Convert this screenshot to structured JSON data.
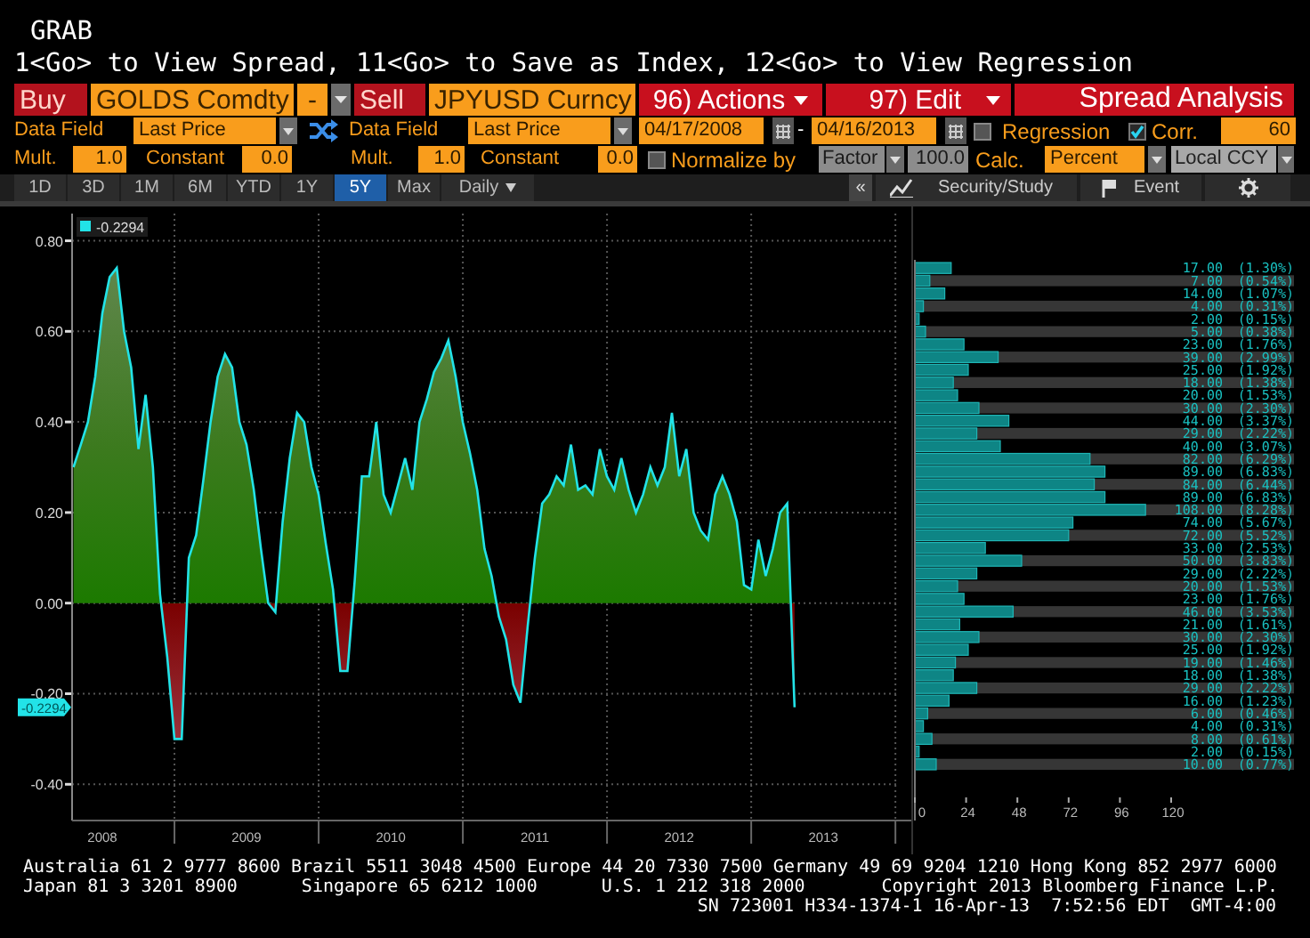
{
  "header": {
    "function": "GRAB",
    "hint": "1<Go> to View Spread, 11<Go> to Save as Index, 12<Go> to View Regression"
  },
  "row1": {
    "buy": "Buy",
    "security_1": "GOLDS Comdty",
    "operator": "-",
    "sell": "Sell",
    "security_2": "JPYUSD Curncy",
    "actions": "96) Actions",
    "edit": "97) Edit",
    "title": "Spread Analysis"
  },
  "row2": {
    "label_1": "Data Field",
    "field_1": "Last Price",
    "label_2": "Data Field",
    "field_2": "Last Price",
    "start_date": "04/17/2008",
    "date_separator": "-",
    "end_date": "04/16/2013",
    "regression": {
      "label": "Regression",
      "checked": false
    },
    "correlation": {
      "label": "Corr.",
      "checked": true
    },
    "window": "60"
  },
  "row3": {
    "mult_label_1": "Mult.",
    "mult_1": "1.0",
    "constant_label_1": "Constant",
    "constant_1": "0.0",
    "mult_label_2": "Mult.",
    "mult_2": "1.0",
    "constant_label_2": "Constant",
    "constant_2": "0.0",
    "normalize": {
      "label": "Normalize by",
      "checked": false
    },
    "normalize_mode": "Factor",
    "factor": "100.0",
    "calc_label": "Calc.",
    "calc": "Percent",
    "currency": "Local CCY"
  },
  "toolbar": {
    "periods": [
      {
        "label": "1D",
        "selected": false
      },
      {
        "label": "3D",
        "selected": false
      },
      {
        "label": "1M",
        "selected": false
      },
      {
        "label": "6M",
        "selected": false
      },
      {
        "label": "YTD",
        "selected": false
      },
      {
        "label": "1Y",
        "selected": false
      },
      {
        "label": "5Y",
        "selected": true
      },
      {
        "label": "Max",
        "selected": false
      }
    ],
    "frequency": "Daily",
    "collapse": "«",
    "study": "Security/Study",
    "event": "Event"
  },
  "chart": {
    "last_value_tag": "-0.2294",
    "chart_data": {
      "type": "area",
      "grid": true,
      "xlim": [
        2007.79,
        2013.53
      ],
      "ylim": [
        -0.48,
        0.86
      ],
      "xticks": [
        2008,
        2009,
        2010,
        2011,
        2012,
        2013
      ],
      "yticks": [
        {
          "value": 0.8,
          "label": "0.80"
        },
        {
          "value": 0.6,
          "label": "0.60"
        },
        {
          "value": 0.4,
          "label": "0.40"
        },
        {
          "value": 0.2,
          "label": "0.20"
        },
        {
          "value": 0,
          "label": "0.00"
        },
        {
          "value": -0.2,
          "label": "-0.20"
        },
        {
          "value": -0.4,
          "label": "-0.40"
        }
      ],
      "x": [
        2007.8,
        2007.85,
        2007.9,
        2007.95,
        2008.0,
        2008.05,
        2008.1,
        2008.15,
        2008.2,
        2008.25,
        2008.3,
        2008.35,
        2008.4,
        2008.45,
        2008.5,
        2008.55,
        2008.6,
        2008.65,
        2008.7,
        2008.75,
        2008.8,
        2008.85,
        2008.9,
        2008.95,
        2009.0,
        2009.05,
        2009.1,
        2009.15,
        2009.2,
        2009.25,
        2009.3,
        2009.35,
        2009.4,
        2009.45,
        2009.5,
        2009.55,
        2009.6,
        2009.65,
        2009.7,
        2009.75,
        2009.8,
        2009.85,
        2009.9,
        2009.95,
        2010.0,
        2010.05,
        2010.1,
        2010.15,
        2010.2,
        2010.25,
        2010.3,
        2010.35,
        2010.4,
        2010.45,
        2010.5,
        2010.55,
        2010.6,
        2010.65,
        2010.7,
        2010.75,
        2010.8,
        2010.85,
        2010.9,
        2010.95,
        2011.0,
        2011.05,
        2011.1,
        2011.15,
        2011.2,
        2011.25,
        2011.3,
        2011.35,
        2011.4,
        2011.45,
        2011.5,
        2011.55,
        2011.6,
        2011.65,
        2011.7,
        2011.75,
        2011.8,
        2011.85,
        2011.9,
        2011.95,
        2012.0,
        2012.05,
        2012.1,
        2012.15,
        2012.2,
        2012.25,
        2012.3,
        2012.35,
        2012.4,
        2012.45,
        2012.5,
        2012.55,
        2012.6,
        2012.65,
        2012.7,
        2012.75,
        2012.8
      ],
      "series": [
        {
          "name": "-0.2294",
          "color": "#22e3e8",
          "values": [
            0.3,
            0.35,
            0.4,
            0.5,
            0.64,
            0.72,
            0.74,
            0.6,
            0.52,
            0.34,
            0.46,
            0.3,
            0.02,
            -0.12,
            -0.3,
            -0.3,
            0.1,
            0.15,
            0.27,
            0.4,
            0.5,
            0.55,
            0.52,
            0.4,
            0.35,
            0.25,
            0.12,
            0.0,
            -0.02,
            0.18,
            0.32,
            0.42,
            0.4,
            0.3,
            0.24,
            0.13,
            0.03,
            -0.15,
            -0.15,
            0.05,
            0.28,
            0.28,
            0.4,
            0.24,
            0.2,
            0.26,
            0.32,
            0.25,
            0.4,
            0.45,
            0.51,
            0.54,
            0.58,
            0.5,
            0.4,
            0.33,
            0.25,
            0.12,
            0.06,
            -0.03,
            -0.08,
            -0.18,
            -0.22,
            -0.05,
            0.1,
            0.22,
            0.24,
            0.28,
            0.26,
            0.35,
            0.25,
            0.26,
            0.24,
            0.34,
            0.28,
            0.25,
            0.32,
            0.25,
            0.2,
            0.24,
            0.3,
            0.26,
            0.3,
            0.42,
            0.28,
            0.34,
            0.2,
            0.16,
            0.14,
            0.24,
            0.28,
            0.24,
            0.18,
            0.04,
            0.03,
            0.14,
            0.06,
            0.12,
            0.2,
            0.22,
            -0.23
          ]
        }
      ]
    }
  },
  "histogram": {
    "bins": [
      {
        "count": "17.00",
        "share": "(1.30%)"
      },
      {
        "count": "7.00",
        "share": "(0.54%)"
      },
      {
        "count": "14.00",
        "share": "(1.07%)"
      },
      {
        "count": "4.00",
        "share": "(0.31%)"
      },
      {
        "count": "2.00",
        "share": "(0.15%)"
      },
      {
        "count": "5.00",
        "share": "(0.38%)"
      },
      {
        "count": "23.00",
        "share": "(1.76%)"
      },
      {
        "count": "39.00",
        "share": "(2.99%)"
      },
      {
        "count": "25.00",
        "share": "(1.92%)"
      },
      {
        "count": "18.00",
        "share": "(1.38%)"
      },
      {
        "count": "20.00",
        "share": "(1.53%)"
      },
      {
        "count": "30.00",
        "share": "(2.30%)"
      },
      {
        "count": "44.00",
        "share": "(3.37%)"
      },
      {
        "count": "29.00",
        "share": "(2.22%)"
      },
      {
        "count": "40.00",
        "share": "(3.07%)"
      },
      {
        "count": "82.00",
        "share": "(6.29%)"
      },
      {
        "count": "89.00",
        "share": "(6.83%)"
      },
      {
        "count": "84.00",
        "share": "(6.44%)"
      },
      {
        "count": "89.00",
        "share": "(6.83%)"
      },
      {
        "count": "108.00",
        "share": "(8.28%)"
      },
      {
        "count": "74.00",
        "share": "(5.67%)"
      },
      {
        "count": "72.00",
        "share": "(5.52%)"
      },
      {
        "count": "33.00",
        "share": "(2.53%)"
      },
      {
        "count": "50.00",
        "share": "(3.83%)"
      },
      {
        "count": "29.00",
        "share": "(2.22%)"
      },
      {
        "count": "20.00",
        "share": "(1.53%)"
      },
      {
        "count": "23.00",
        "share": "(1.76%)"
      },
      {
        "count": "46.00",
        "share": "(3.53%)"
      },
      {
        "count": "21.00",
        "share": "(1.61%)"
      },
      {
        "count": "30.00",
        "share": "(2.30%)"
      },
      {
        "count": "25.00",
        "share": "(1.92%)"
      },
      {
        "count": "19.00",
        "share": "(1.46%)"
      },
      {
        "count": "18.00",
        "share": "(1.38%)"
      },
      {
        "count": "29.00",
        "share": "(2.22%)"
      },
      {
        "count": "16.00",
        "share": "(1.23%)"
      },
      {
        "count": "6.00",
        "share": "(0.46%)"
      },
      {
        "count": "4.00",
        "share": "(0.31%)"
      },
      {
        "count": "8.00",
        "share": "(0.61%)"
      },
      {
        "count": "2.00",
        "share": "(0.15%)"
      },
      {
        "count": "10.00",
        "share": "(0.77%)"
      }
    ],
    "chart_data": {
      "type": "bar",
      "orientation": "horizontal",
      "xlim": [
        0,
        120
      ],
      "xticks": [
        0,
        24,
        48,
        72,
        96,
        120
      ],
      "series": [
        {
          "color": "#0e8585",
          "values": [
            17,
            7,
            14,
            4,
            2,
            5,
            23,
            39,
            25,
            18,
            20,
            30,
            44,
            29,
            40,
            82,
            89,
            84,
            89,
            108,
            74,
            72,
            33,
            50,
            29,
            20,
            23,
            46,
            21,
            30,
            25,
            19,
            18,
            29,
            16,
            6,
            4,
            8,
            2,
            10
          ]
        }
      ]
    }
  },
  "footer": {
    "line_1": "Australia 61 2 9777 8600 Brazil 5511 3048 4500 Europe 44 20 7330 7500 Germany 49 69 9204 1210 Hong Kong 852 2977 6000",
    "japan": "Japan 81 3 3201 8900",
    "singapore": "Singapore 65 6212 1000",
    "us": "U.S. 1 212 318 2000",
    "copyright": "Copyright 2013 Bloomberg Finance L.P.",
    "session": "SN 723001 H334-1374-1 16-Apr-13  7:52:56 EDT  GMT-4:00"
  }
}
